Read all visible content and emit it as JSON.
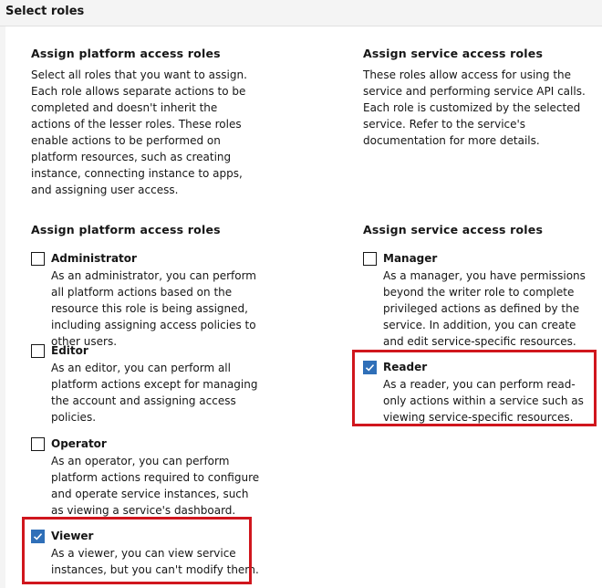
{
  "section": {
    "title": "Select roles"
  },
  "platform": {
    "intro_title": "Assign platform access roles",
    "intro_desc": "Select all roles that you want to assign. Each role allows separate actions to be completed and doesn't inherit the actions of the lesser roles. These roles enable actions to be performed on platform resources, such as creating instance, connecting instance to apps, and assigning user access.",
    "roles_title": "Assign platform access roles",
    "roles": [
      {
        "name": "Administrator",
        "checked": false,
        "desc": "As an administrator, you can perform all platform actions based on the resource this role is being assigned, including assigning access policies to other users."
      },
      {
        "name": "Editor",
        "checked": false,
        "desc": "As an editor, you can perform all platform actions except for managing the account and assigning access policies."
      },
      {
        "name": "Operator",
        "checked": false,
        "desc": "As an operator, you can perform platform actions required to configure and operate service instances, such as viewing a service's dashboard."
      },
      {
        "name": "Viewer",
        "checked": true,
        "desc": "As a viewer, you can view service instances, but you can't modify them."
      }
    ]
  },
  "service": {
    "intro_title": "Assign service access roles",
    "intro_desc": "These roles allow access for using the service and performing service API calls. Each role is customized by the selected service. Refer to the service's documentation for more details.",
    "roles_title": "Assign service access roles",
    "roles": [
      {
        "name": "Manager",
        "checked": false,
        "desc": "As a manager, you have permissions beyond the writer role to complete privileged actions as defined by the service. In addition, you can create and edit service-specific resources."
      },
      {
        "name": "Reader",
        "checked": true,
        "desc": "As a reader, you can perform read-only actions within a service such as viewing service-specific resources."
      }
    ]
  },
  "colors": {
    "checkbox_checked": "#2f6fb8",
    "highlight": "#d0161d"
  }
}
